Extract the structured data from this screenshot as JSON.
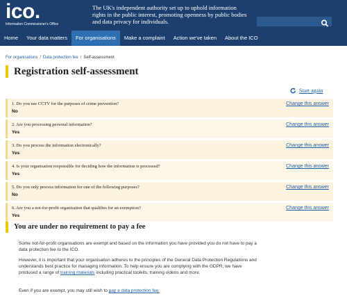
{
  "header": {
    "logo": "ico.",
    "logo_sub": "Information Commissioner's Office",
    "tagline": "The UK's independent authority set up to uphold information rights in the public interest, promoting openness by public bodies and data privacy for individuals.",
    "search_placeholder": "",
    "search_icon": "search-icon"
  },
  "nav": {
    "items": [
      "Home",
      "Your data matters",
      "For organisations",
      "Make a complaint",
      "Action we've taken",
      "About the ICO"
    ],
    "active_index": 2
  },
  "breadcrumb": {
    "items": [
      "For organisations",
      "Data protection fee",
      "Self-assessment"
    ],
    "separator": "/"
  },
  "page": {
    "title": "Registration self-assessment",
    "start_again": "Start again"
  },
  "answers": [
    {
      "question": "1. Do you use CCTV for the purposes of crime prevention?",
      "answer": "No",
      "change": "Change this answer"
    },
    {
      "question": "2. Are you processing personal information?",
      "answer": "Yes",
      "change": "Change this answer"
    },
    {
      "question": "3. Do you process the information electronically?",
      "answer": "Yes",
      "change": "Change this answer"
    },
    {
      "question": "4. Is your organisation responsible for deciding how the information is processed?",
      "answer": "Yes",
      "change": "Change this answer"
    },
    {
      "question": "5. Do you only process information for one of the following purposes?",
      "answer": "No",
      "change": "Change this answer"
    },
    {
      "question": "6. Are you a not-for-profit organisation that qualifies for an exemption?",
      "answer": "Yes",
      "change": "Change this answer"
    }
  ],
  "result": {
    "title": "You are under no requirement to pay a fee",
    "p1": "Some not-for-profit organisations are exempt and based on the information you have provided you do not have to pay a data protection fee to the ICO.",
    "p2_text": "However, it is important that your organisation adheres to the principles of the General Data Protection Regulations and understands best practice for managing information. To help ensure you are complying with the GDPR, we have produced a range of ",
    "p2_link": "training materials",
    "p2_tail": " including practical toolkits, training videos and more.",
    "p3_text": "Even if you are exempt, you may still wish to ",
    "p3_link": "pay a data protection fee."
  },
  "colors": {
    "header_bg": "#1d3f6e",
    "nav_active": "#2d6fb0",
    "accent_yellow": "#f5c400",
    "link": "#1d5fa8",
    "row_bg": "#fbf3df"
  }
}
